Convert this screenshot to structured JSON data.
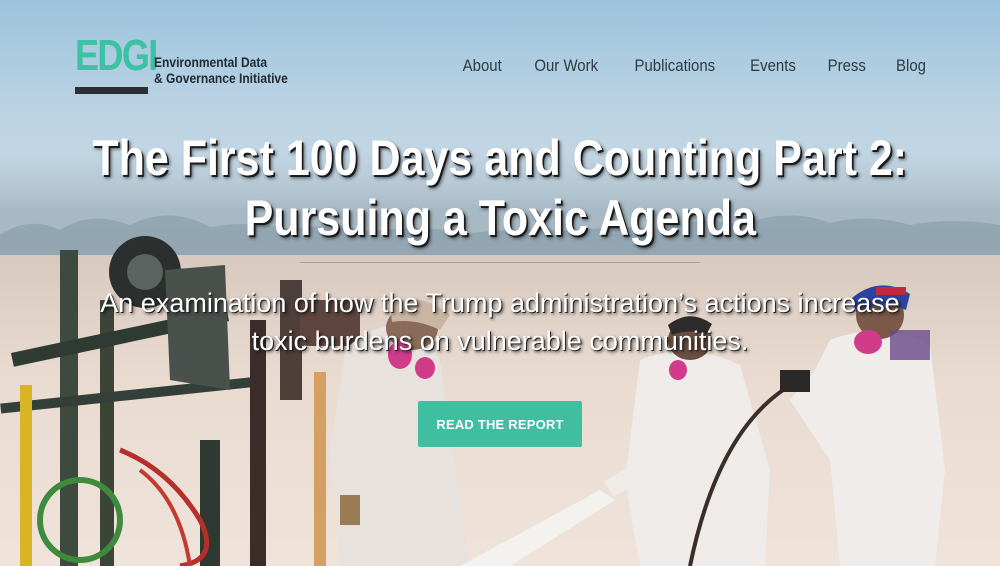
{
  "logo": {
    "mark": "EDGI",
    "name_line1": "Environmental Data",
    "name_line2": "& Governance Initiative"
  },
  "nav": {
    "items": [
      "About",
      "Our Work",
      "Publications",
      "Events",
      "Press",
      "Blog"
    ]
  },
  "hero": {
    "title_line1": "The First 100 Days and Counting Part 2:",
    "title_line2": "Pursuing a Toxic Agenda",
    "subtitle_line1": "An examination of how the Trump administration’s actions increase",
    "subtitle_line2": "toxic burdens on vulnerable communities.",
    "cta_label": "READ THE REPORT"
  },
  "colors": {
    "accent": "#3fbea0",
    "logo": "#3cc1a3",
    "nav_text": "#2d3a42"
  }
}
